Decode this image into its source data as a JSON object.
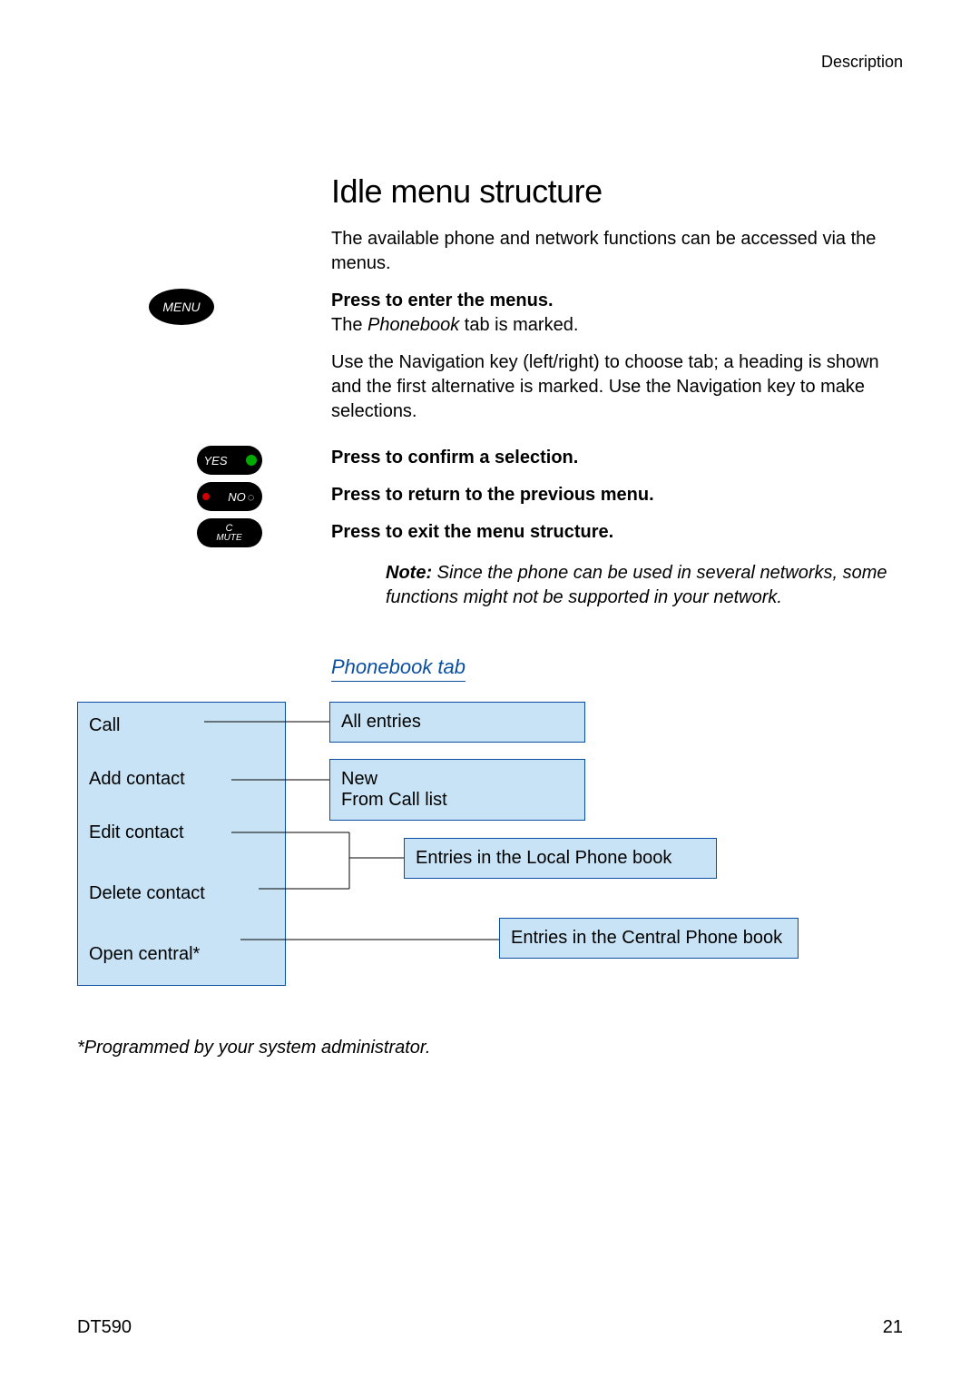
{
  "header": {
    "section": "Description"
  },
  "title": "Idle menu structure",
  "intro": "The available phone and network functions can be accessed via the menus.",
  "steps": {
    "menu": {
      "icon_label": "MENU",
      "bold": "Press to enter the menus.",
      "line1_prefix": "The ",
      "line1_em": "Phonebook",
      "line1_suffix": " tab is marked.",
      "para2": "Use the Navigation key (left/right) to choose tab; a heading is shown and the first alternative is marked. Use the Navigation key to make selections."
    },
    "yes": {
      "icon_label": "YES",
      "text": "Press to confirm a selection."
    },
    "no": {
      "icon_label": "NO",
      "text": "Press to return to the previous menu."
    },
    "mute": {
      "icon_top": "C",
      "icon_bottom": "MUTE",
      "text": "Press to exit the menu structure."
    }
  },
  "note": {
    "label": "Note:",
    "text": "Since the phone can be used in several networks, some functions might not be supported in your network."
  },
  "subhead": "Phonebook tab",
  "diagram": {
    "menu": [
      "Call",
      "Add contact",
      "Edit contact",
      "Delete contact",
      "Open central*"
    ],
    "box1": "All entries",
    "box2_line1": "New",
    "box2_line2": "From Call list",
    "box3": "Entries in the Local Phone book",
    "box4": "Entries in the Central Phone book",
    "footnote": "*Programmed by your system administrator."
  },
  "footer": {
    "model": "DT590",
    "page": "21"
  }
}
